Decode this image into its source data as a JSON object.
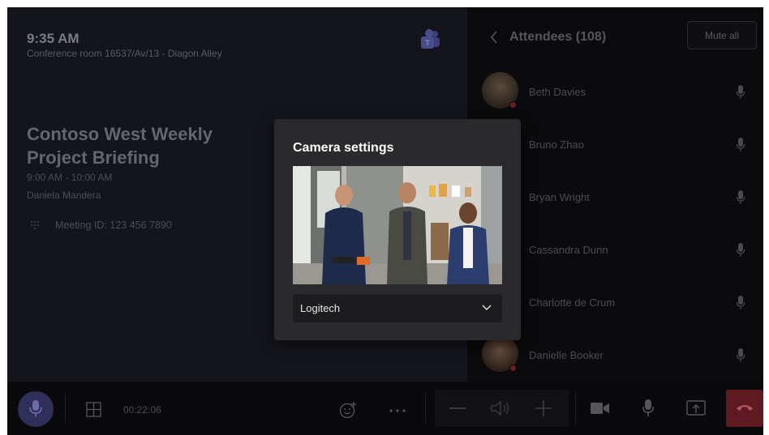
{
  "header": {
    "time": "9:35 AM",
    "room": "Conference room 16537/Av/13 - Diagon Alley"
  },
  "meeting": {
    "title": "Contoso West Weekly Project Briefing",
    "time_range": "9:00 AM - 10:00 AM",
    "organizer": "Daniela Mandera",
    "meeting_id": "Meeting ID: 123 456 7890"
  },
  "attendees_panel": {
    "title": "Attendees (108)",
    "mute_all_label": "Mute all",
    "attendees": [
      {
        "name": "Beth Davies"
      },
      {
        "name": "Bruno Zhao"
      },
      {
        "name": "Bryan Wright"
      },
      {
        "name": "Cassandra Dunn"
      },
      {
        "name": "Charlotte de Crum"
      },
      {
        "name": "Danielle Booker"
      }
    ]
  },
  "call_bar": {
    "duration": "00:22:06"
  },
  "camera_dialog": {
    "title": "Camera settings",
    "selected_camera": "Logitech"
  },
  "colors": {
    "hangup": "#c4314b",
    "mic_active": "#6264a7",
    "dialog_bg": "#2a2a2d"
  },
  "icons": [
    "teams-logo",
    "dialpad-icon",
    "back-chevron-icon",
    "microphone-icon",
    "layout-grid-icon",
    "reaction-icon",
    "more-options-icon",
    "volume-icon",
    "camera-icon",
    "share-screen-icon",
    "hang-up-icon",
    "chevron-down-icon"
  ]
}
